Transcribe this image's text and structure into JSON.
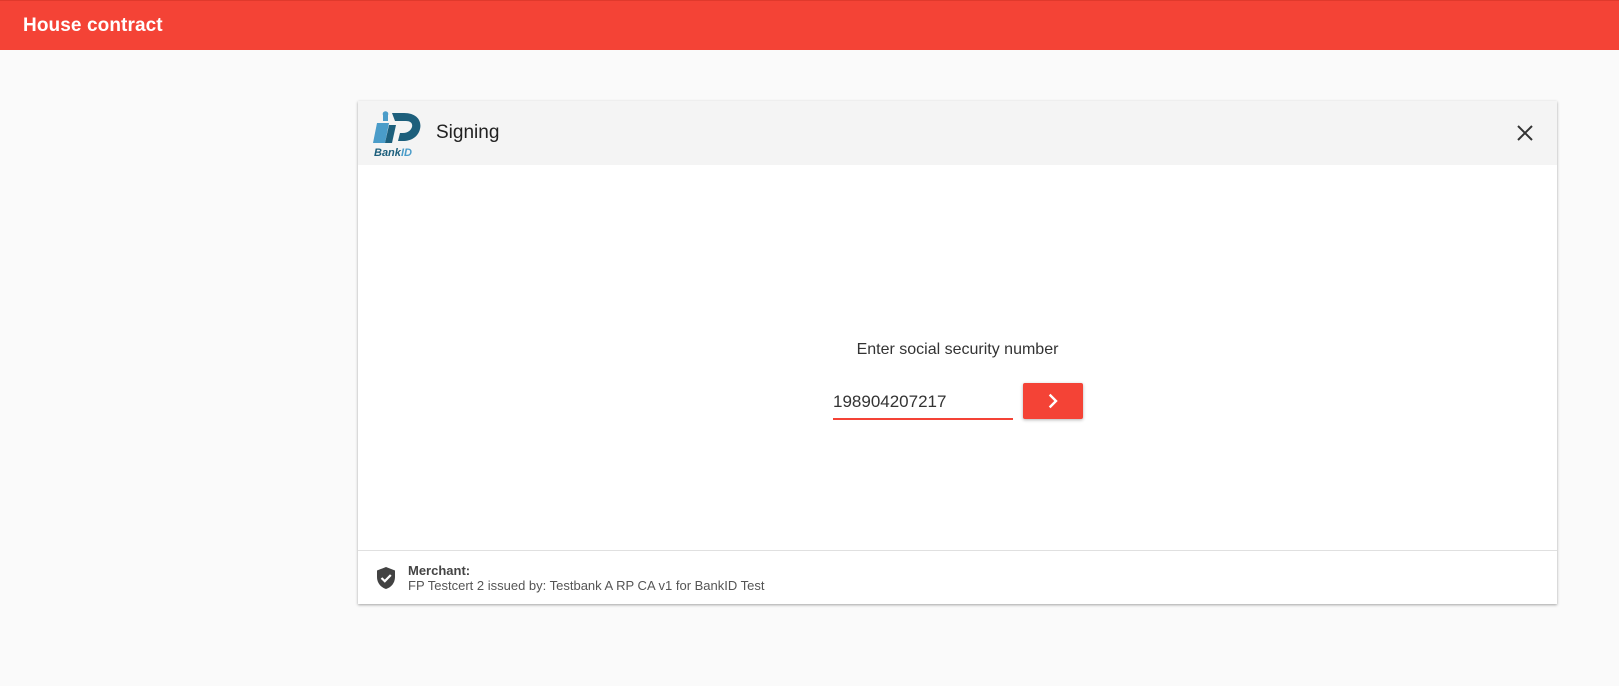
{
  "app": {
    "title": "House contract",
    "accent_color": "#f44336"
  },
  "dialog": {
    "title": "Signing",
    "logo_icon": "bankid-logo-icon",
    "logo_text": "BankID",
    "close_icon": "close-icon"
  },
  "form": {
    "prompt": "Enter social security number",
    "ssn_value": "198904207217",
    "submit_icon": "chevron-right-icon"
  },
  "footer": {
    "icon": "shield-check-icon",
    "merchant_label": "Merchant:",
    "merchant_value": "FP Testcert 2 issued by: Testbank A RP CA v1 for BankID Test"
  }
}
